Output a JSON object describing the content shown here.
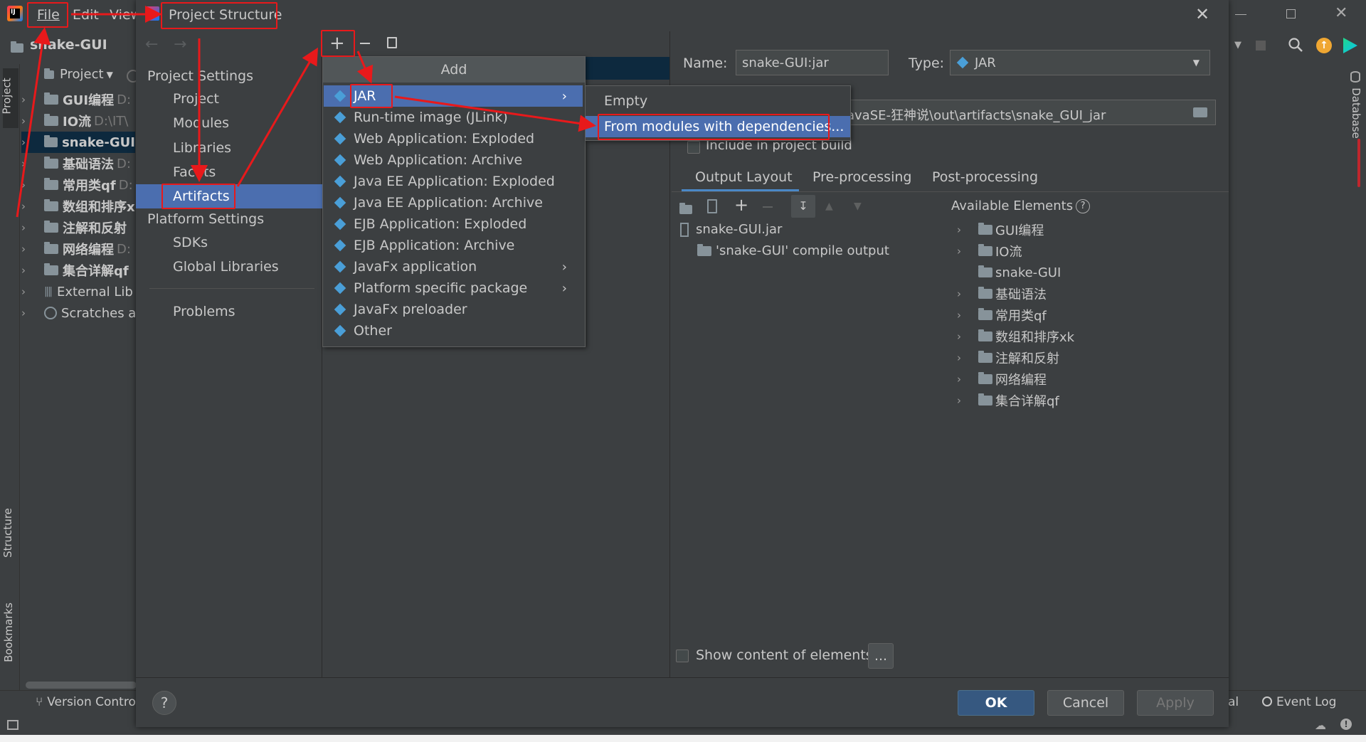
{
  "menubar": {
    "file": "File",
    "edit": "Edit",
    "view": "View"
  },
  "ide": {
    "project_name": "snake-GUI",
    "tool_project": "Project",
    "left_tabs": {
      "project": "Project",
      "structure": "Structure",
      "bookmarks": "Bookmarks"
    },
    "right_tabs": {
      "database": "Database"
    }
  },
  "project_tree": [
    {
      "label": "GUI编程",
      "suffix": "D:"
    },
    {
      "label": "IO流",
      "suffix": "D:\\IT\\"
    },
    {
      "label": "snake-GUI",
      "suffix": ""
    },
    {
      "label": "基础语法",
      "suffix": "D:"
    },
    {
      "label": "常用类qf",
      "suffix": "D:"
    },
    {
      "label": "数组和排序x",
      "suffix": ""
    },
    {
      "label": "注解和反射",
      "suffix": ""
    },
    {
      "label": "网络编程",
      "suffix": "D:"
    },
    {
      "label": "集合详解qf",
      "suffix": ""
    },
    {
      "label": "External Lib",
      "suffix": ""
    },
    {
      "label": "Scratches a",
      "suffix": ""
    }
  ],
  "dialog": {
    "title": "Project Structure",
    "section_project_settings": "Project Settings",
    "nav_project": "Project",
    "nav_modules": "Modules",
    "nav_libraries": "Libraries",
    "nav_facets": "Facets",
    "nav_artifacts": "Artifacts",
    "section_platform_settings": "Platform Settings",
    "nav_sdks": "SDKs",
    "nav_global_libraries": "Global Libraries",
    "nav_problems": "Problems",
    "name_label": "Name:",
    "name_value": "snake-GUI:jar",
    "type_label": "Type:",
    "type_value": "JAR",
    "output_dir_value": "avaSE-狂神说\\out\\artifacts\\snake_GUI_jar",
    "include_build": "Include in project build",
    "tabs": {
      "output_layout": "Output Layout",
      "pre_processing": "Pre-processing",
      "post_processing": "Post-processing"
    },
    "output_tree": {
      "root": "snake-GUI.jar",
      "child": "'snake-GUI' compile output"
    },
    "available_elements": "Available Elements",
    "available": [
      "GUI编程",
      "IO流",
      "snake-GUI",
      "基础语法",
      "常用类qf",
      "数组和排序xk",
      "注解和反射",
      "网络编程",
      "集合详解qf"
    ],
    "show_content": "Show content of elements",
    "ellipsis": "...",
    "ok": "OK",
    "cancel": "Cancel",
    "apply": "Apply",
    "help": "?"
  },
  "add_menu": {
    "title": "Add",
    "items": [
      "JAR",
      "Run-time image (JLink)",
      "Web Application: Exploded",
      "Web Application: Archive",
      "Java EE Application: Exploded",
      "Java EE Application: Archive",
      "EJB Application: Exploded",
      "EJB Application: Archive",
      "JavaFx application",
      "Platform specific package",
      "JavaFx preloader",
      "Other"
    ]
  },
  "jar_submenu": {
    "empty": "Empty",
    "from_modules": "From modules with dependencies..."
  },
  "statusbar": {
    "version_control": "Version Control",
    "event_log": "Event Log",
    "partial": "al"
  },
  "colors": {
    "accent": "#4b6eaf",
    "selection": "#0d293e",
    "annotation": "#e8191b"
  }
}
